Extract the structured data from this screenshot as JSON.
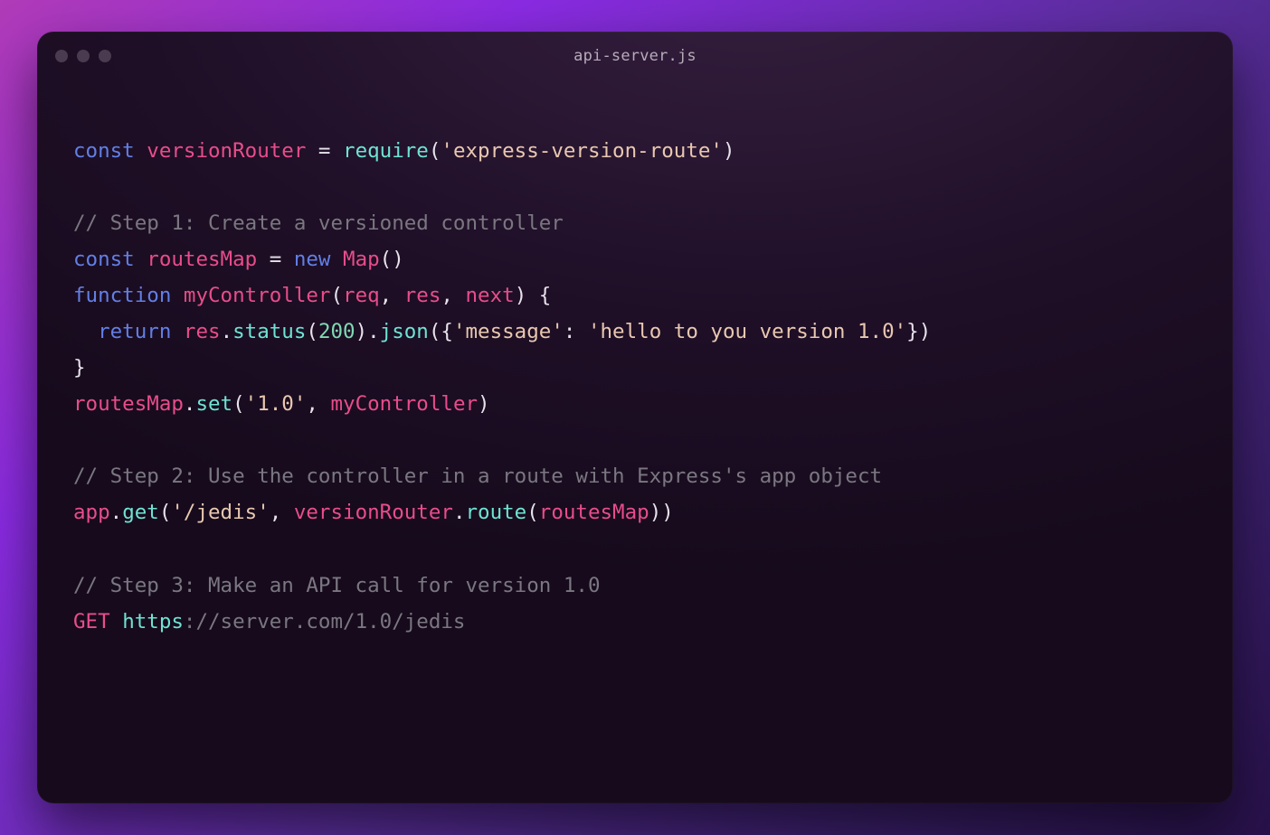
{
  "window": {
    "title": "api-server.js"
  },
  "code": {
    "l1": {
      "const": "const",
      "versionRouter": "versionRouter",
      "eq": " = ",
      "require": "require",
      "p1": "(",
      "str": "'express-version-route'",
      "p2": ")"
    },
    "l3": {
      "cmt": "// Step 1: Create a versioned controller"
    },
    "l4": {
      "const": "const",
      "routesMap": "routesMap",
      "eq": " = ",
      "new": "new",
      "sp": " ",
      "Map": "Map",
      "p1": "(",
      "p2": ")"
    },
    "l5": {
      "function": "function",
      "sp": " ",
      "myController": "myController",
      "p1": "(",
      "req": "req",
      "c1": ", ",
      "res": "res",
      "c2": ", ",
      "next": "next",
      "p2": ")",
      "sp2": " ",
      "brace1": "{"
    },
    "l6": {
      "indent": "  ",
      "return": "return",
      "sp": " ",
      "res": "res",
      "d1": ".",
      "status": "status",
      "p1": "(",
      "num": "200",
      "p2": ")",
      "d2": ".",
      "json": "json",
      "p3": "(",
      "brace1": "{",
      "strk": "'message'",
      "colon": ": ",
      "strv": "'hello to you version 1.0'",
      "brace2": "}",
      "p4": ")"
    },
    "l7": {
      "brace2": "}"
    },
    "l8": {
      "routesMap": "routesMap",
      "d1": ".",
      "set": "set",
      "p1": "(",
      "str": "'1.0'",
      "c1": ", ",
      "myController": "myController",
      "p2": ")"
    },
    "l10": {
      "cmt": "// Step 2: Use the controller in a route with Express's app object"
    },
    "l11": {
      "app": "app",
      "d1": ".",
      "get": "get",
      "p1": "(",
      "str": "'/jedis'",
      "c1": ", ",
      "versionRouter": "versionRouter",
      "d2": ".",
      "route": "route",
      "p2": "(",
      "routesMap": "routesMap",
      "p3": ")",
      "p4": ")"
    },
    "l13": {
      "cmt": "// Step 3: Make an API call for version 1.0"
    },
    "l14": {
      "GET": "GET",
      "sp": " ",
      "https": "https",
      "rest": "://server.com/1.0/jedis"
    }
  }
}
